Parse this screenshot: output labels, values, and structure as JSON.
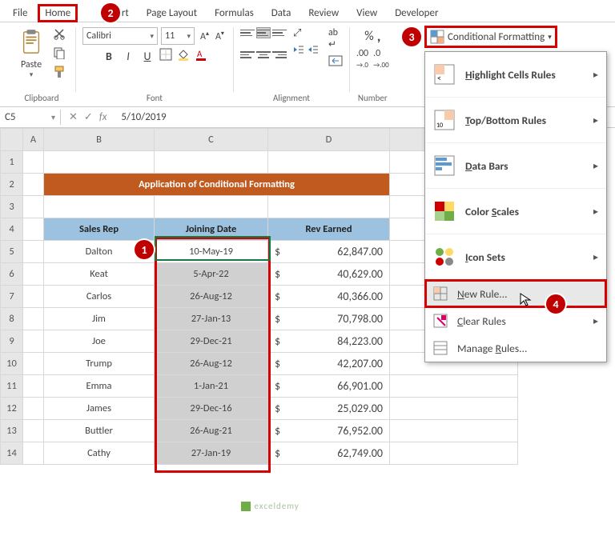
{
  "tabs": [
    "File",
    "Home",
    "Insert",
    "Page Layout",
    "Formulas",
    "Data",
    "Review",
    "View",
    "Developer"
  ],
  "active_tab": "Home",
  "ribbon": {
    "paste": "Paste",
    "clipboard": "Clipboard",
    "font_name": "Calibri",
    "font_size": "11",
    "font_group": "Font",
    "align_group": "Alignment",
    "num_group": "Number",
    "cf_label": "Conditional Formatting"
  },
  "dropdown": {
    "highlight": "Highlight Cells Rules",
    "topbottom": "Top/Bottom Rules",
    "databars": "Data Bars",
    "colorscales": "Color Scales",
    "iconsets": "Icon Sets",
    "newrule": "New Rule...",
    "clearrules": "Clear Rules",
    "managerules": "Manage Rules...",
    "u_h": "H",
    "u_t": "T",
    "u_d": "D",
    "u_s": "S",
    "u_i": "I",
    "u_n": "N",
    "u_c": "C",
    "u_r": "R"
  },
  "namebox": "C5",
  "formula": "5/10/2019",
  "cols": [
    "A",
    "B",
    "C",
    "D"
  ],
  "title": "Application of Conditional Formatting",
  "headers": {
    "rep": "Sales Rep",
    "join": "Joining Date",
    "rev": "Rev Earned"
  },
  "rows": [
    {
      "n": "5",
      "rep": "Dalton",
      "date": "10-May-19",
      "rev": "62,847.00"
    },
    {
      "n": "6",
      "rep": "Keat",
      "date": "5-Apr-22",
      "rev": "40,629.00"
    },
    {
      "n": "7",
      "rep": "Carlos",
      "date": "26-Aug-12",
      "rev": "40,366.00"
    },
    {
      "n": "8",
      "rep": "Jim",
      "date": "27-Jan-13",
      "rev": "70,798.00"
    },
    {
      "n": "9",
      "rep": "Joe",
      "date": "29-Dec-21",
      "rev": "84,223.00"
    },
    {
      "n": "10",
      "rep": "Trump",
      "date": "26-Aug-12",
      "rev": "42,207.00"
    },
    {
      "n": "11",
      "rep": "Emma",
      "date": "1-Jan-21",
      "rev": "66,901.00"
    },
    {
      "n": "12",
      "rep": "James",
      "date": "29-Dec-16",
      "rev": "25,029.00"
    },
    {
      "n": "13",
      "rep": "Buttler",
      "date": "26-Aug-21",
      "rev": "76,952.00"
    },
    {
      "n": "14",
      "rep": "Cathy",
      "date": "27-Jan-19",
      "rev": "62,749.00"
    }
  ],
  "dollar": "$",
  "watermark": "exceldemy"
}
